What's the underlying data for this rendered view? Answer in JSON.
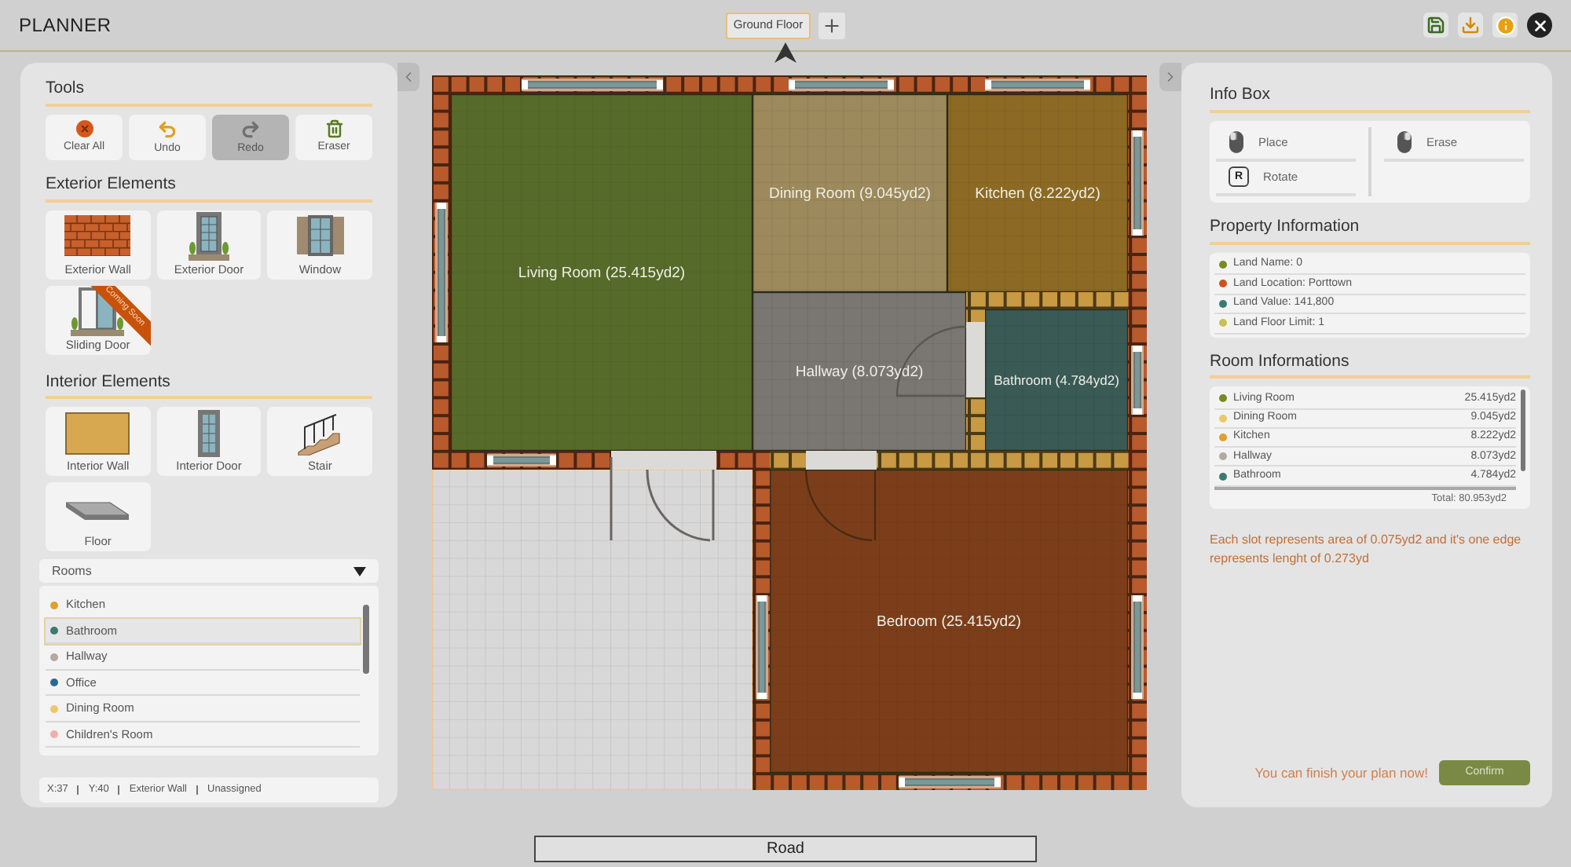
{
  "app": {
    "title": "PLANNER"
  },
  "floor_selector": {
    "value": "Ground Floor"
  },
  "tools": {
    "title": "Tools",
    "items": [
      {
        "label": "Clear All",
        "kind": "clear",
        "selected": false
      },
      {
        "label": "Undo",
        "kind": "undo",
        "selected": false
      },
      {
        "label": "Redo",
        "kind": "redo",
        "selected": true
      },
      {
        "label": "Eraser",
        "kind": "eraser",
        "selected": false
      }
    ]
  },
  "exterior": {
    "title": "Exterior Elements",
    "items": [
      {
        "label": "Exterior Wall",
        "kind": "brick"
      },
      {
        "label": "Exterior Door",
        "kind": "door"
      },
      {
        "label": "Window",
        "kind": "window"
      },
      {
        "label": "Sliding Door",
        "kind": "sliding",
        "ribbon": "Coming Soon"
      }
    ]
  },
  "interior": {
    "title": "Interior Elements",
    "items": [
      {
        "label": "Interior Wall",
        "kind": "panel"
      },
      {
        "label": "Interior Door",
        "kind": "idoor"
      },
      {
        "label": "Stair",
        "kind": "stair"
      },
      {
        "label": "Floor",
        "kind": "floor"
      }
    ]
  },
  "rooms_dropdown": {
    "label": "Rooms",
    "items": [
      {
        "label": "Kitchen",
        "color": "#e0a02a",
        "selected": false
      },
      {
        "label": "Bathroom",
        "color": "#3a7a70",
        "selected": true
      },
      {
        "label": "Hallway",
        "color": "#b0aaa0",
        "selected": false
      },
      {
        "label": "Office",
        "color": "#2a6a90",
        "selected": false
      },
      {
        "label": "Dining Room",
        "color": "#ecc868",
        "selected": false
      },
      {
        "label": "Children's Room",
        "color": "#f0b0a8",
        "selected": false
      }
    ]
  },
  "status_bar": [
    "X:37",
    "Y:40",
    "Exterior Wall",
    "Unassigned"
  ],
  "plan": {
    "rooms": [
      {
        "kind": "living",
        "label": "Living Room (25.415yd2)",
        "color": "#566b2a"
      },
      {
        "kind": "dining",
        "label": "Dining Room (9.045yd2)",
        "color": "#9c8a5c"
      },
      {
        "kind": "kitchen",
        "label": "Kitchen (8.222yd2)",
        "color": "#8c6a24"
      },
      {
        "kind": "hallway",
        "label": "Hallway (8.073yd2)",
        "color": "#7a7672"
      },
      {
        "kind": "bathroom",
        "label": "Bathroom (4.784yd2)",
        "color": "#3a5a56"
      },
      {
        "kind": "bedroom",
        "label": "Bedroom (25.415yd2)",
        "color": "#7c3e1a"
      }
    ]
  },
  "road": "Road",
  "info_box": {
    "title": "Info Box",
    "actions": [
      {
        "label": "Place",
        "kind": "left-click"
      },
      {
        "label": "Erase",
        "kind": "right-click"
      },
      {
        "label": "Rotate",
        "kind": "key",
        "key": "R"
      }
    ]
  },
  "property": {
    "title": "Property Information",
    "items": [
      {
        "label": "Land Name: 0",
        "color": "#7a8a22"
      },
      {
        "label": "Land Location: Porttown",
        "color": "#d0501a"
      },
      {
        "label": "Land Value: 141,800",
        "color": "#3a7a70"
      },
      {
        "label": "Land Floor Limit: 1",
        "color": "#c8c050"
      }
    ]
  },
  "room_info": {
    "title": "Room Informations",
    "items": [
      {
        "name": "Living Room",
        "area": "25.415yd2",
        "color": "#7a8a22"
      },
      {
        "name": "Dining Room",
        "area": "9.045yd2",
        "color": "#ecc868"
      },
      {
        "name": "Kitchen",
        "area": "8.222yd2",
        "color": "#e0a02a"
      },
      {
        "name": "Hallway",
        "area": "8.073yd2",
        "color": "#b0aaa0"
      },
      {
        "name": "Bathroom",
        "area": "4.784yd2",
        "color": "#3a7a70"
      }
    ],
    "total": "Total: 80.953yd2"
  },
  "note": "Each slot represents area of 0.075yd2 and it's one edge represents lenght of 0.273yd",
  "finish": {
    "message": "You can finish your plan now!",
    "button": "Confirm"
  }
}
